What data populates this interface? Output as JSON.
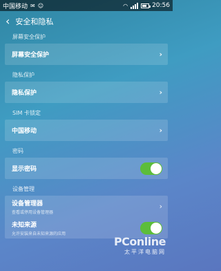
{
  "status_bar": {
    "carrier": "中国移动",
    "time": "20:56"
  },
  "nav": {
    "back_icon": "chevron-left-icon",
    "title": "安全和隐私"
  },
  "sections": [
    {
      "label": "屏幕安全保护",
      "item": "屏幕安全保护"
    },
    {
      "label": "隐私保护",
      "item": "隐私保护"
    },
    {
      "label": "SIM 卡锁定",
      "item": "中国移动"
    },
    {
      "label": "密码",
      "item": "显示密码",
      "toggle": true
    }
  ],
  "device_mgmt": {
    "label": "设备管理",
    "items": [
      {
        "title": "设备管理器",
        "subtitle": "查看或停用设备管理器"
      },
      {
        "title": "未知来源",
        "subtitle": "允许安装来自未知来源的应用",
        "toggle": true
      }
    ]
  },
  "watermark": {
    "brand": "PConline",
    "tagline": "太平洋电脑网"
  },
  "colors": {
    "toggle_on": "#5cbd3a"
  }
}
